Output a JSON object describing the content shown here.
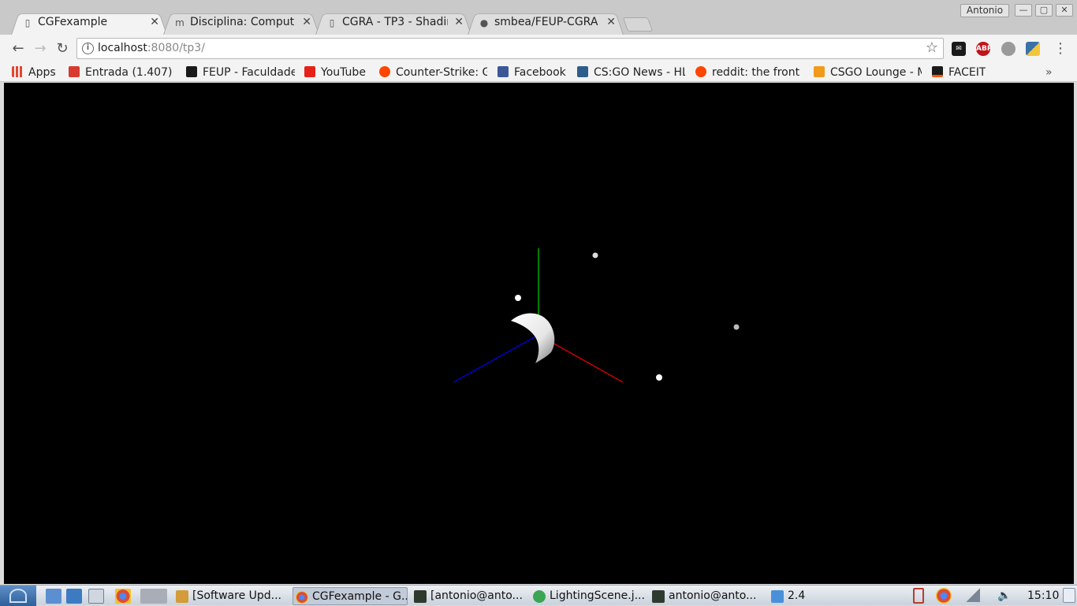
{
  "window": {
    "profile_name": "Antonio",
    "controls": [
      "—",
      "▢",
      "✕"
    ]
  },
  "tabs": [
    {
      "title": "CGFexample",
      "icon": "page-icon",
      "close": "✕",
      "active": true
    },
    {
      "title": "Disciplina: Comput",
      "icon": "moodle-icon",
      "close": "✕",
      "active": false
    },
    {
      "title": "CGRA - TP3 - Shadin",
      "icon": "page-icon",
      "close": "✕",
      "active": false
    },
    {
      "title": "smbea/FEUP-CGRA",
      "icon": "github-icon",
      "close": "✕",
      "active": false
    }
  ],
  "toolbar": {
    "back": "←",
    "forward": "→",
    "reload": "↻",
    "url_host": "localhost",
    "url_rest": ":8080/tp3/",
    "star": "☆",
    "extensions": [
      {
        "name": "email-ext-icon",
        "label": "off",
        "color": "#1a1a1a"
      },
      {
        "name": "adblock-icon",
        "label": "ABP",
        "color": "#c0141b"
      },
      {
        "name": "incognito-ext-icon",
        "label": "",
        "color": "#9a9a9a"
      },
      {
        "name": "python-icon",
        "label": "",
        "color": "#3a70a8"
      }
    ],
    "menu": "⋮"
  },
  "bookmarks": {
    "items": [
      {
        "label": "Apps",
        "icon": "apps-grid-icon",
        "color": "#e2452f"
      },
      {
        "label": "Entrada (1.407) -",
        "icon": "gmail-icon",
        "color": "#d73a2e"
      },
      {
        "label": "FEUP - Faculdade",
        "icon": "feup-icon",
        "color": "#1a1a1a"
      },
      {
        "label": "YouTube",
        "icon": "youtube-icon",
        "color": "#e62117"
      },
      {
        "label": "Counter-Strike: G",
        "icon": "reddit-icon",
        "color": "#ff4500"
      },
      {
        "label": "Facebook",
        "icon": "facebook-icon",
        "color": "#3b5998"
      },
      {
        "label": "CS:GO News - HL",
        "icon": "hltv-icon",
        "color": "#2d5d8c"
      },
      {
        "label": "reddit: the front",
        "icon": "reddit-icon",
        "color": "#ff4500"
      },
      {
        "label": "CSGO Lounge - M",
        "icon": "csgolounge-icon",
        "color": "#f19a1b"
      },
      {
        "label": "FACEIT",
        "icon": "faceit-icon",
        "color": "#ff5500"
      }
    ],
    "more": "»"
  },
  "scene": {
    "background": "#000000",
    "axis_x_color": "#cc0000",
    "axis_y_color": "#00aa00",
    "axis_z_color": "#0000cc",
    "object": "shaded curved surface",
    "light_markers": 4
  },
  "taskbar": {
    "items": [
      {
        "label": "[Software Upd...",
        "icon": "software-update-icon",
        "color": "#d49b3a",
        "active": false
      },
      {
        "label": "CGFexample - G...",
        "icon": "chrome-icon",
        "color": "#dd4b39",
        "active": true
      },
      {
        "label": "[antonio@anto...",
        "icon": "terminal-icon",
        "color": "#2f3a2f",
        "active": false
      },
      {
        "label": "LightingScene.j...",
        "icon": "editor-icon",
        "color": "#3aa655",
        "active": false
      },
      {
        "label": "antonio@anto...",
        "icon": "terminal-icon",
        "color": "#2f3a2f",
        "active": false
      },
      {
        "label": "2.4",
        "icon": "folder-icon",
        "color": "#4a90d9",
        "active": false
      }
    ],
    "clock": "15:10"
  }
}
